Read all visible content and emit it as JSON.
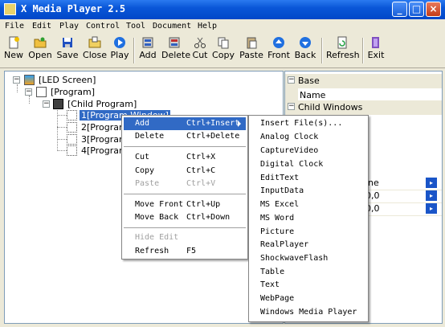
{
  "window": {
    "title": "X Media Player 2.5"
  },
  "menu": [
    "File",
    "Edit",
    "Play",
    "Control",
    "Tool",
    "Document",
    "Help"
  ],
  "toolbar": {
    "new": "New",
    "open": "Open",
    "save": "Save",
    "close": "Close",
    "play": "Play",
    "add": "Add",
    "delete": "Delete",
    "cut": "Cut",
    "copy": "Copy",
    "paste": "Paste",
    "front": "Front",
    "back": "Back",
    "refresh": "Refresh",
    "exit": "Exit"
  },
  "tree": {
    "root": "[LED Screen]",
    "program": "[Program]",
    "child": "[Child Program]",
    "items": [
      "1[Program Window]",
      "2[Program",
      "3[Program",
      "4[Program"
    ]
  },
  "props": {
    "base_header": "Base",
    "name_label": "Name",
    "child_header": "Child Windows",
    "partial_row1": "ine",
    "partial_row2": "0,0",
    "partial_row3": "0,0"
  },
  "context_menu": {
    "items": [
      {
        "label": "Add",
        "key": "Ctrl+Insert",
        "submenu": true,
        "highlighted": true
      },
      {
        "label": "Delete",
        "key": "Ctrl+Delete"
      },
      {
        "label": "Cut",
        "key": "Ctrl+X"
      },
      {
        "label": "Copy",
        "key": "Ctrl+C"
      },
      {
        "label": "Paste",
        "key": "Ctrl+V",
        "disabled": true
      },
      {
        "label": "Move Front",
        "key": "Ctrl+Up"
      },
      {
        "label": "Move Back",
        "key": "Ctrl+Down"
      },
      {
        "label": "Hide Edit",
        "key": "",
        "disabled": true
      },
      {
        "label": "Refresh",
        "key": "F5"
      }
    ]
  },
  "submenu": [
    "Insert File(s)...",
    "Analog Clock",
    "CaptureVideo",
    "Digital Clock",
    "EditText",
    "InputData",
    "MS Excel",
    "MS Word",
    "Picture",
    "RealPlayer",
    "ShockwaveFlash",
    "Table",
    "Text",
    "WebPage",
    "Windows Media Player"
  ],
  "colors": {
    "titlebar": "#0a56d8",
    "highlight": "#316ac5",
    "chrome": "#ece9d8"
  }
}
